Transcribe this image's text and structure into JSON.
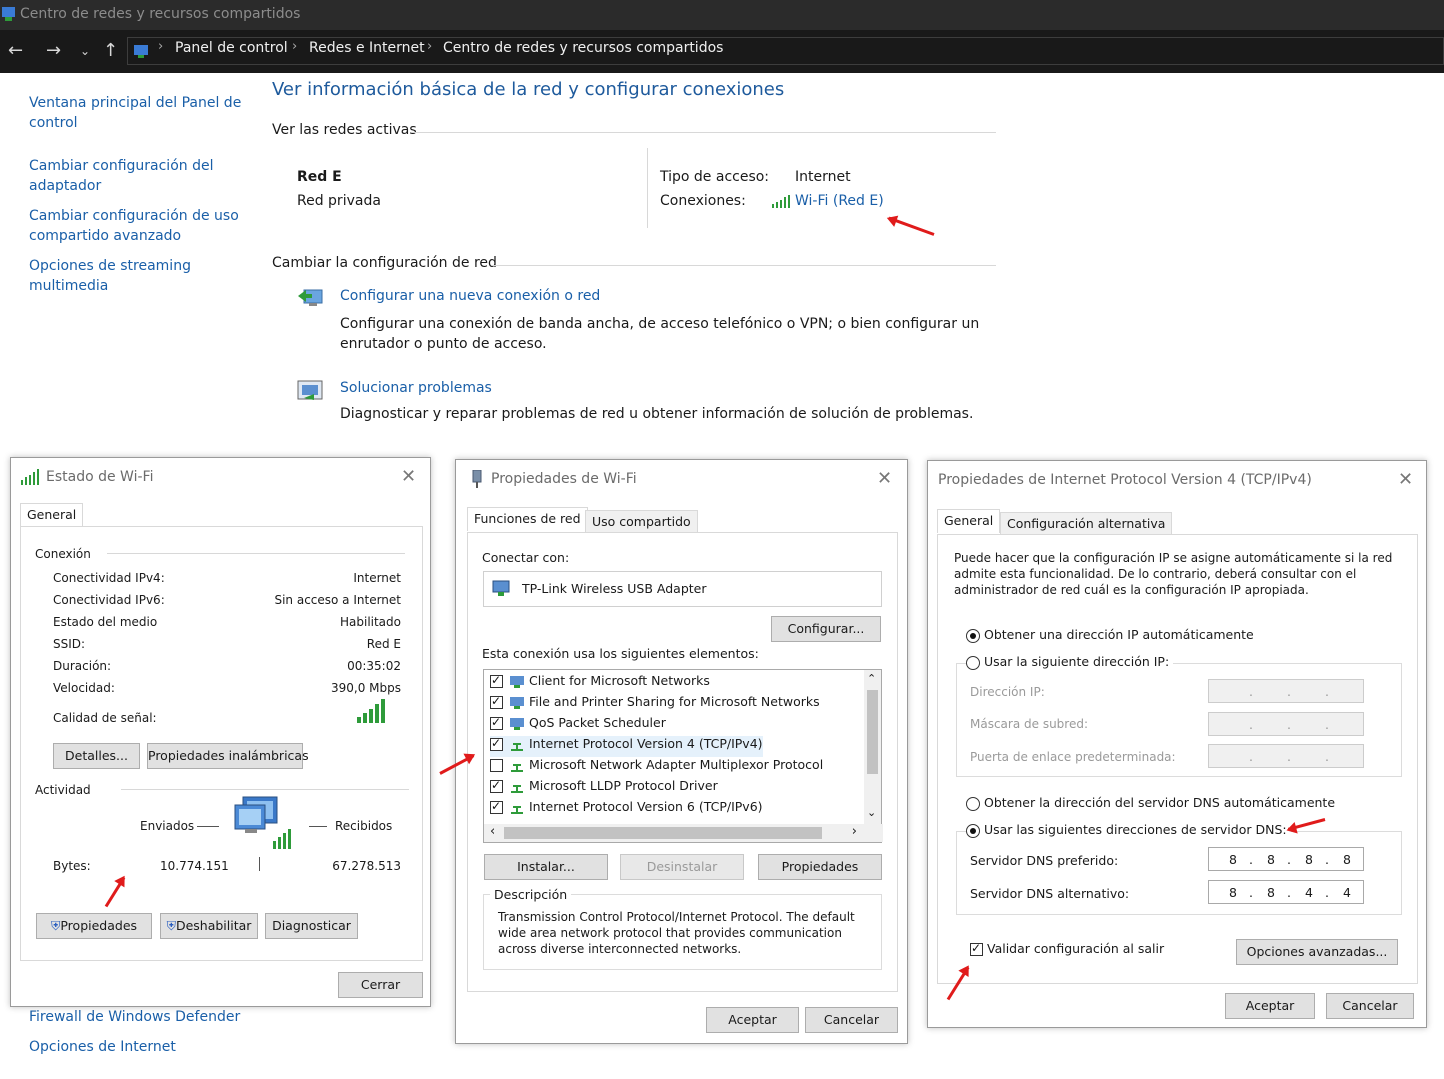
{
  "window": {
    "title": "Centro de redes y recursos compartidos",
    "breadcrumb": [
      "Panel de control",
      "Redes e Internet",
      "Centro de redes y recursos compartidos"
    ]
  },
  "sidebar": {
    "items": [
      {
        "label": "Ventana principal del Panel de control"
      },
      {
        "label": "Cambiar configuración del adaptador"
      },
      {
        "label": "Cambiar configuración de uso compartido avanzado"
      },
      {
        "label": "Opciones de streaming multimedia"
      }
    ],
    "see_also": [
      "Firewall de Windows Defender",
      "Opciones de Internet"
    ]
  },
  "main": {
    "heading": "Ver información básica de la red y configurar conexiones",
    "active_section": "Ver las redes activas",
    "network_name": "Red E",
    "network_type": "Red privada",
    "access_type_label": "Tipo de acceso:",
    "access_type_value": "Internet",
    "connections_label": "Conexiones:",
    "connections_value": "Wi-Fi (Red E)",
    "change_section": "Cambiar la configuración de red",
    "tasks": [
      {
        "link": "Configurar una nueva conexión o red",
        "desc": "Configurar una conexión de banda ancha, de acceso telefónico o VPN; o bien configurar un enrutador o punto de acceso."
      },
      {
        "link": "Solucionar problemas",
        "desc": "Diagnosticar y reparar problemas de red u obtener información de solución de problemas."
      }
    ]
  },
  "wifi_status": {
    "title": "Estado de Wi-Fi",
    "tab": "General",
    "connection_group": "Conexión",
    "rows": [
      {
        "label": "Conectividad IPv4:",
        "value": "Internet"
      },
      {
        "label": "Conectividad IPv6:",
        "value": "Sin acceso a Internet"
      },
      {
        "label": "Estado del medio",
        "value": "Habilitado"
      },
      {
        "label": "SSID:",
        "value": "Red E"
      },
      {
        "label": "Duración:",
        "value": "00:35:02"
      },
      {
        "label": "Velocidad:",
        "value": "390,0 Mbps"
      }
    ],
    "signal_label": "Calidad de señal:",
    "details_button": "Detalles...",
    "wireless_props_button": "Propiedades inalámbricas",
    "activity_group": "Actividad",
    "sent_label": "Enviados",
    "received_label": "Recibidos",
    "bytes_label": "Bytes:",
    "bytes_sent": "10.774.151",
    "bytes_received": "67.278.513",
    "properties_button": "Propiedades",
    "disable_button": "Deshabilitar",
    "diagnose_button": "Diagnosticar",
    "close_button": "Cerrar"
  },
  "wifi_props": {
    "title": "Propiedades de Wi-Fi",
    "tabs": [
      "Funciones de red",
      "Uso compartido"
    ],
    "connect_with_label": "Conectar con:",
    "adapter": "TP-Link Wireless USB Adapter",
    "configure_button": "Configurar...",
    "items_label": "Esta conexión usa los siguientes elementos:",
    "items": [
      {
        "label": "Client for Microsoft Networks",
        "checked": true
      },
      {
        "label": "File and Printer Sharing for Microsoft Networks",
        "checked": true
      },
      {
        "label": "QoS Packet Scheduler",
        "checked": true
      },
      {
        "label": "Internet Protocol Version 4 (TCP/IPv4)",
        "checked": true
      },
      {
        "label": "Microsoft Network Adapter Multiplexor Protocol",
        "checked": false
      },
      {
        "label": "Microsoft LLDP Protocol Driver",
        "checked": true
      },
      {
        "label": "Internet Protocol Version 6 (TCP/IPv6)",
        "checked": true
      }
    ],
    "install_button": "Instalar...",
    "uninstall_button": "Desinstalar",
    "properties_button": "Propiedades",
    "description_group": "Descripción",
    "description": "Transmission Control Protocol/Internet Protocol. The default wide area network protocol that provides communication across diverse interconnected networks.",
    "ok_button": "Aceptar",
    "cancel_button": "Cancelar"
  },
  "ipv4_props": {
    "title": "Propiedades de Internet Protocol Version 4 (TCP/IPv4)",
    "tabs": [
      "General",
      "Configuración alternativa"
    ],
    "intro": "Puede hacer que la configuración IP se asigne automáticamente si la red admite esta funcionalidad. De lo contrario, deberá consultar con el administrador de red cuál es la configuración IP apropiada.",
    "auto_ip": "Obtener una dirección IP automáticamente",
    "manual_ip": "Usar la siguiente dirección IP:",
    "ip_label": "Dirección IP:",
    "mask_label": "Máscara de subred:",
    "gateway_label": "Puerta de enlace predeterminada:",
    "auto_dns": "Obtener la dirección del servidor DNS automáticamente",
    "manual_dns": "Usar las siguientes direcciones de servidor DNS:",
    "preferred_dns_label": "Servidor DNS preferido:",
    "preferred_dns": [
      "8",
      "8",
      "8",
      "8"
    ],
    "alternate_dns_label": "Servidor DNS alternativo:",
    "alternate_dns": [
      "8",
      "8",
      "4",
      "4"
    ],
    "validate_label": "Validar configuración al salir",
    "advanced_button": "Opciones avanzadas...",
    "ok_button": "Aceptar",
    "cancel_button": "Cancelar"
  },
  "colors": {
    "accent": "#e01b1b",
    "link": "#1a5fa8",
    "heading": "#1e5a9c",
    "titlebar": "#2b2b2b"
  }
}
